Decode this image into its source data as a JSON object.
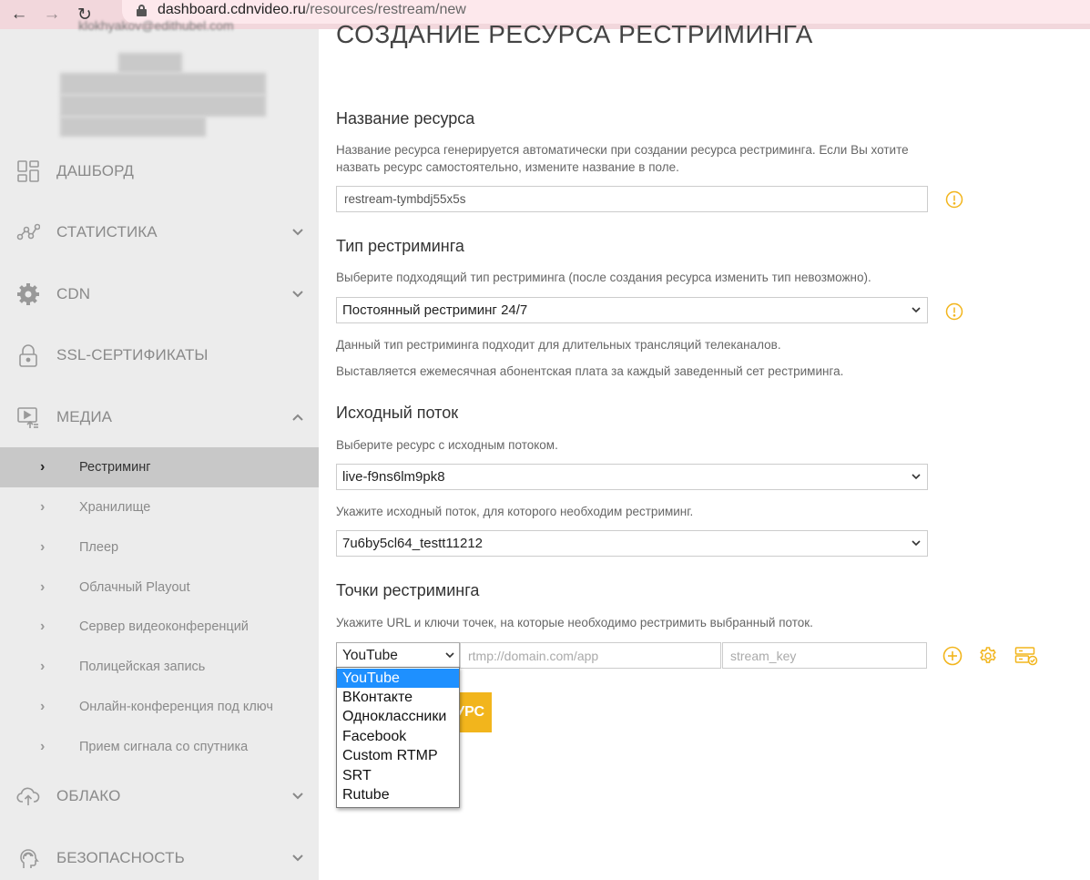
{
  "browser": {
    "back_glyph": "←",
    "forward_glyph": "→",
    "reload_glyph": "↻",
    "url_host": "dashboard.cdnvideo.ru",
    "url_path": "/resources/restream/new"
  },
  "sidebar": {
    "user_email_partial": "klokhyakov@edithubel.com",
    "nav": [
      {
        "label": "ДАШБОРД",
        "icon": "dashboard-icon",
        "chevron": "none"
      },
      {
        "label": "СТАТИСТИКА",
        "icon": "statistics-icon",
        "chevron": "down"
      },
      {
        "label": "CDN",
        "icon": "gear-icon",
        "chevron": "down"
      },
      {
        "label": "SSL-СЕРТИФИКАТЫ",
        "icon": "lock-icon",
        "chevron": "none"
      },
      {
        "label": "МЕДИА",
        "icon": "media-icon",
        "chevron": "up"
      },
      {
        "label": "ОБЛАКО",
        "icon": "cloud-upload-icon",
        "chevron": "down"
      },
      {
        "label": "БЕЗОПАСНОСТЬ",
        "icon": "security-icon",
        "chevron": "down"
      }
    ],
    "media_sub": [
      {
        "label": "Рестриминг",
        "active": true
      },
      {
        "label": "Хранилище",
        "active": false
      },
      {
        "label": "Плеер",
        "active": false
      },
      {
        "label": "Облачный Playout",
        "active": false
      },
      {
        "label": "Сервер видеоконференций",
        "active": false
      },
      {
        "label": "Полицейская запись",
        "active": false
      },
      {
        "label": "Онлайн-конференция под ключ",
        "active": false
      },
      {
        "label": "Прием сигнала со спутника",
        "active": false
      }
    ],
    "sub_chevron_glyph": "›"
  },
  "main": {
    "page_title": "СОЗДАНИЕ РЕСУРСА РЕСТРИМИНГА",
    "resource_name": {
      "title": "Название ресурса",
      "hint": "Название ресурса генерируется автоматически при создании ресурса рестриминга. Если Вы хотите назвать ресурс самостоятельно, измените название в поле.",
      "value": "restream-tymbdj55x5s"
    },
    "restream_type": {
      "title": "Тип рестриминга",
      "hint": "Выберите подходящий тип рестриминга (после создания ресурса изменить тип невозможно).",
      "value": "Постоянный рестриминг 24/7",
      "note1": "Данный тип рестриминга подходит для длительных трансляций телеканалов.",
      "note2": "Выставляется ежемесячная абонентская плата за каждый заведенный сет рестриминга."
    },
    "source_stream": {
      "title": "Исходный поток",
      "hint": "Выберите ресурс с исходным потоком.",
      "resource_value": "live-f9ns6lm9pk8",
      "stream_hint": "Укажите исходный поток, для которого необходим рестриминг.",
      "stream_value": "7u6by5cl64_testt11212"
    },
    "points": {
      "title": "Точки рестриминга",
      "hint": "Укажите URL и ключи точек, на которые необходимо рестримить выбранный поток.",
      "platform_value": "YouTube",
      "url_placeholder": "rtmp://domain.com/app",
      "key_placeholder": "stream_key",
      "options": [
        "YouTube",
        "ВКонтакте",
        "Одноклассники",
        "Facebook",
        "Custom RTMP",
        "SRT",
        "Rutube"
      ],
      "selected_option": "YouTube"
    },
    "submit_label_visible": "УРС"
  },
  "colors": {
    "accent": "#f2b51c",
    "sidebar_bg": "#ececec",
    "active_item_bg": "#c8c8c8",
    "browser_bar": "#f2d7dc",
    "dropdown_highlight": "#1e90ff"
  }
}
